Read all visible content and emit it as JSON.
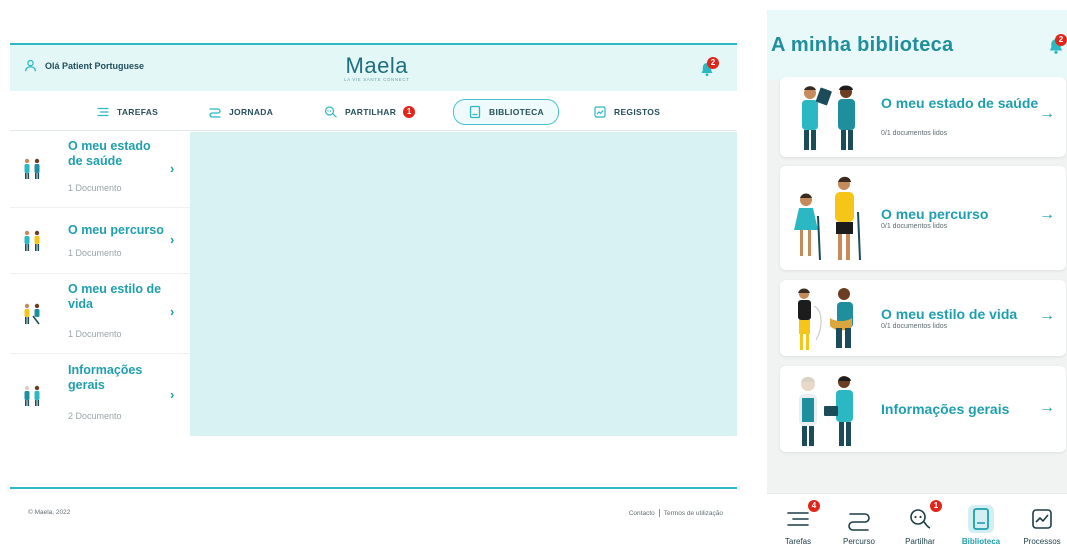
{
  "desktop": {
    "greeting": "Olá Patient Portuguese",
    "logo": {
      "word": "Maela",
      "tagline": "LA VIE SANTE CONNECT"
    },
    "notifications_badge": "2",
    "nav": [
      {
        "label": "TAREFAS",
        "icon": "list-icon"
      },
      {
        "label": "JORNADA",
        "icon": "path-icon"
      },
      {
        "label": "PARTILHAR",
        "icon": "share-chat-icon",
        "badge": "1"
      },
      {
        "label": "BIBLIOTECA",
        "icon": "book-icon",
        "active": true
      },
      {
        "label": "REGISTOS",
        "icon": "chart-icon"
      }
    ],
    "library": [
      {
        "title": "O meu estado de saúde",
        "count": "1 Documento"
      },
      {
        "title": "O meu percurso",
        "count": "1 Documento"
      },
      {
        "title": "O meu estilo de vida",
        "count": "1 Documento"
      },
      {
        "title": "Informações gerais",
        "count": "2 Documento"
      }
    ],
    "footer": {
      "copyright": "© Maela, 2022",
      "contact": "Contacto",
      "terms": "Termos de utilização"
    }
  },
  "mobile": {
    "title": "A minha biblioteca",
    "notifications_badge": "2",
    "cards": [
      {
        "title": "O meu estado de saúde",
        "sub": "0/1 documentos lidos"
      },
      {
        "title": "O meu percurso",
        "sub": "0/1 documentos lidos"
      },
      {
        "title": "O meu estilo de vida",
        "sub": "0/1 documentos lidos"
      },
      {
        "title": "Informações gerais",
        "sub": ""
      }
    ],
    "tabs": [
      {
        "label": "Tarefas",
        "badge": "4"
      },
      {
        "label": "Percurso"
      },
      {
        "label": "Partilhar",
        "badge": "1"
      },
      {
        "label": "Biblioteca",
        "active": true
      },
      {
        "label": "Processos"
      }
    ]
  },
  "colors": {
    "accent": "#1f9fae",
    "rule": "#2bb8c2",
    "panel": "#d8f2f3",
    "badge": "#e0251a"
  }
}
